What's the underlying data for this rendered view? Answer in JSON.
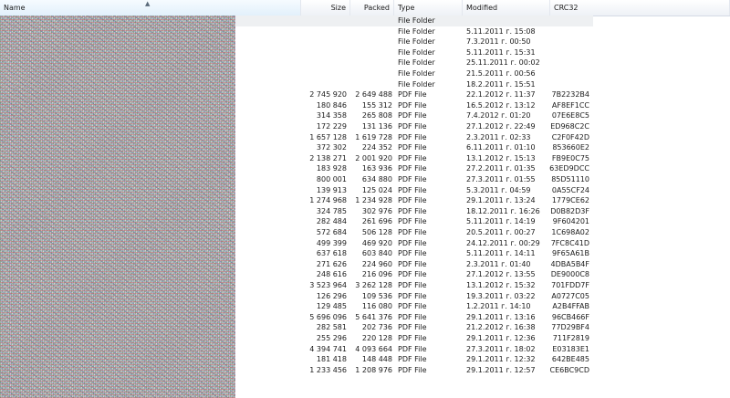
{
  "columns": {
    "name": "Name",
    "size": "Size",
    "packed": "Packed",
    "type": "Type",
    "modified": "Modified",
    "crc": "CRC32"
  },
  "rows": [
    {
      "size": "",
      "packed": "",
      "type": "File Folder",
      "modified": "",
      "crc": ""
    },
    {
      "size": "",
      "packed": "",
      "type": "File Folder",
      "modified": "5.11.2011 г. 15:08",
      "crc": ""
    },
    {
      "size": "",
      "packed": "",
      "type": "File Folder",
      "modified": "7.3.2011 г. 00:50",
      "crc": ""
    },
    {
      "size": "",
      "packed": "",
      "type": "File Folder",
      "modified": "5.11.2011 г. 15:31",
      "crc": ""
    },
    {
      "size": "",
      "packed": "",
      "type": "File Folder",
      "modified": "25.11.2011 г. 00:02",
      "crc": ""
    },
    {
      "size": "",
      "packed": "",
      "type": "File Folder",
      "modified": "21.5.2011 г. 00:56",
      "crc": ""
    },
    {
      "size": "",
      "packed": "",
      "type": "File Folder",
      "modified": "18.2.2011 г. 15:51",
      "crc": ""
    },
    {
      "size": "2 745 920",
      "packed": "2 649 488",
      "type": "PDF File",
      "modified": "22.1.2012 г. 11:37",
      "crc": "7B2232B4"
    },
    {
      "size": "180 846",
      "packed": "155 312",
      "type": "PDF File",
      "modified": "16.5.2012 г. 13:12",
      "crc": "AF8EF1CC"
    },
    {
      "size": "314 358",
      "packed": "265 808",
      "type": "PDF File",
      "modified": "7.4.2012 г. 01:20",
      "crc": "07E6E8C5"
    },
    {
      "size": "172 229",
      "packed": "131 136",
      "type": "PDF File",
      "modified": "27.1.2012 г. 22:49",
      "crc": "ED968C2C"
    },
    {
      "size": "1 657 128",
      "packed": "1 619 728",
      "type": "PDF File",
      "modified": "2.3.2011 г. 02:33",
      "crc": "C2F0F42D"
    },
    {
      "size": "372 302",
      "packed": "224 352",
      "type": "PDF File",
      "modified": "6.11.2011 г. 01:10",
      "crc": "853660E2"
    },
    {
      "size": "2 138 271",
      "packed": "2 001 920",
      "type": "PDF File",
      "modified": "13.1.2012 г. 15:13",
      "crc": "FB9E0C75"
    },
    {
      "size": "183 928",
      "packed": "163 936",
      "type": "PDF File",
      "modified": "27.2.2011 г. 01:35",
      "crc": "63ED9DCC"
    },
    {
      "size": "800 001",
      "packed": "634 880",
      "type": "PDF File",
      "modified": "27.3.2011 г. 01:55",
      "crc": "85D51110"
    },
    {
      "size": "139 913",
      "packed": "125 024",
      "type": "PDF File",
      "modified": "5.3.2011 г. 04:59",
      "crc": "0A55CF24"
    },
    {
      "size": "1 274 968",
      "packed": "1 234 928",
      "type": "PDF File",
      "modified": "29.1.2011 г. 13:24",
      "crc": "1779CE62"
    },
    {
      "size": "324 785",
      "packed": "302 976",
      "type": "PDF File",
      "modified": "18.12.2011 г. 16:26",
      "crc": "D0B82D3F"
    },
    {
      "size": "282 484",
      "packed": "261 696",
      "type": "PDF File",
      "modified": "5.11.2011 г. 14:19",
      "crc": "9F604201"
    },
    {
      "size": "572 684",
      "packed": "506 128",
      "type": "PDF File",
      "modified": "20.5.2011 г. 00:27",
      "crc": "1C698A02"
    },
    {
      "size": "499 399",
      "packed": "469 920",
      "type": "PDF File",
      "modified": "24.12.2011 г. 00:29",
      "crc": "7FC8C41D"
    },
    {
      "size": "637 618",
      "packed": "603 840",
      "type": "PDF File",
      "modified": "5.11.2011 г. 14:11",
      "crc": "9F65A61B"
    },
    {
      "size": "271 626",
      "packed": "224 960",
      "type": "PDF File",
      "modified": "2.3.2011 г. 01:40",
      "crc": "4DBA5B4F"
    },
    {
      "size": "248 616",
      "packed": "216 096",
      "type": "PDF File",
      "modified": "27.1.2012 г. 13:55",
      "crc": "DE9000C8"
    },
    {
      "size": "3 523 964",
      "packed": "3 262 128",
      "type": "PDF File",
      "modified": "13.1.2012 г. 15:32",
      "crc": "701FDD7F"
    },
    {
      "size": "126 296",
      "packed": "109 536",
      "type": "PDF File",
      "modified": "19.3.2011 г. 03:22",
      "crc": "A0727C05"
    },
    {
      "size": "129 485",
      "packed": "116 080",
      "type": "PDF File",
      "modified": "1.2.2011 г. 14:10",
      "crc": "A2B4FFAB"
    },
    {
      "size": "5 696 096",
      "packed": "5 641 376",
      "type": "PDF File",
      "modified": "29.1.2011 г. 13:16",
      "crc": "96CB466F"
    },
    {
      "size": "282 581",
      "packed": "202 736",
      "type": "PDF File",
      "modified": "21.2.2012 г. 16:38",
      "crc": "77D29BF4"
    },
    {
      "size": "255 296",
      "packed": "220 128",
      "type": "PDF File",
      "modified": "29.1.2011 г. 12:36",
      "crc": "711F2819"
    },
    {
      "size": "4 394 741",
      "packed": "4 093 664",
      "type": "PDF File",
      "modified": "27.3.2011 г. 18:02",
      "crc": "E03183E1"
    },
    {
      "size": "181 418",
      "packed": "148 448",
      "type": "PDF File",
      "modified": "29.1.2011 г. 12:32",
      "crc": "642BE485"
    },
    {
      "size": "1 233 456",
      "packed": "1 208 976",
      "type": "PDF File",
      "modified": "29.1.2011 г. 12:57",
      "crc": "CE6BC9CD"
    }
  ]
}
